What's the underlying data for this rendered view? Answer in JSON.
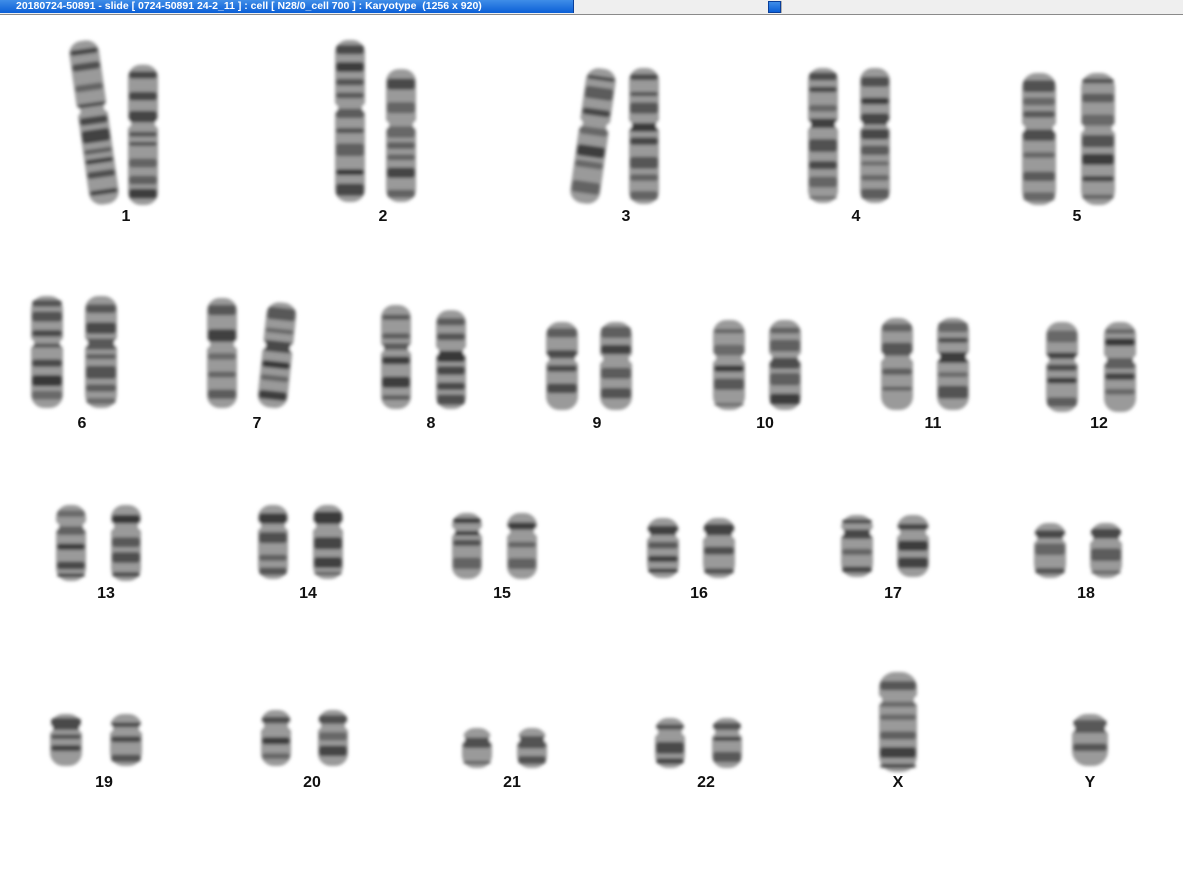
{
  "window": {
    "title": "20180724-50891 - slide [ 0724-50891 24-2_11 ] : cell [ N28/0_cell 700 ] : Karyotype  (1256 x 920)"
  },
  "colors": {
    "title_bar": "#0b5fd6",
    "chromosome": "#333333"
  },
  "karyotype": {
    "chromosomes": [
      {
        "label": "1"
      },
      {
        "label": "2"
      },
      {
        "label": "3"
      },
      {
        "label": "4"
      },
      {
        "label": "5"
      },
      {
        "label": "6"
      },
      {
        "label": "7"
      },
      {
        "label": "8"
      },
      {
        "label": "9"
      },
      {
        "label": "10"
      },
      {
        "label": "11"
      },
      {
        "label": "12"
      },
      {
        "label": "13"
      },
      {
        "label": "14"
      },
      {
        "label": "15"
      },
      {
        "label": "16"
      },
      {
        "label": "17"
      },
      {
        "label": "18"
      },
      {
        "label": "19"
      },
      {
        "label": "20"
      },
      {
        "label": "21"
      },
      {
        "label": "22"
      },
      {
        "label": "X"
      },
      {
        "label": "Y"
      }
    ]
  }
}
